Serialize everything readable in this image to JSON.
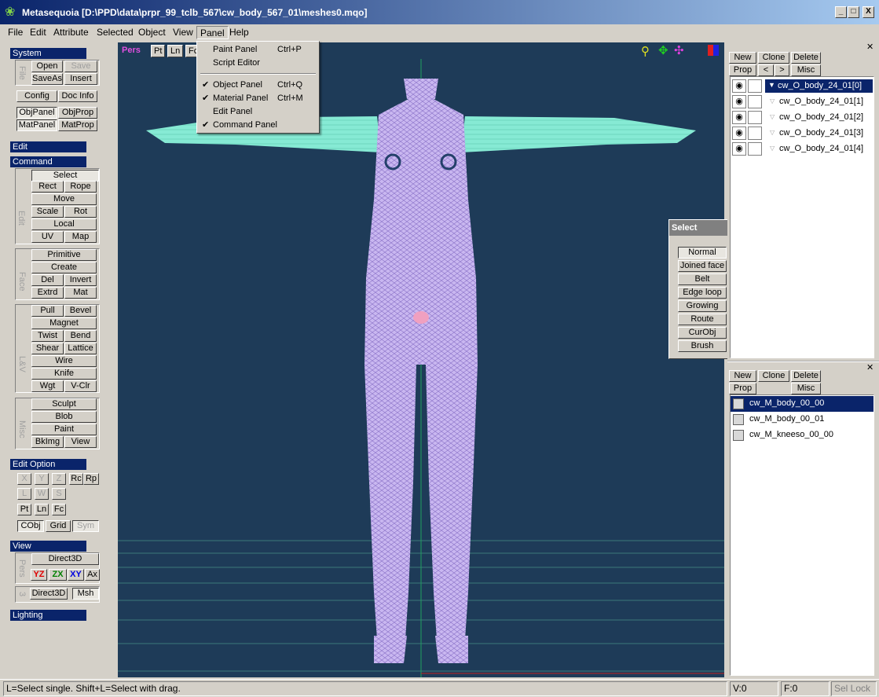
{
  "window": {
    "title": "Metasequoia [D:\\PPD\\data\\prpr_99_tclb_567\\cw_body_567_01\\meshes0.mqo]",
    "minimize": "_",
    "maximize": "□",
    "close": "X"
  },
  "menu": [
    "File",
    "Edit",
    "Attribute",
    "Selected",
    "Object",
    "View",
    "Panel",
    "Help"
  ],
  "panel_menu": {
    "items": [
      {
        "label": "Paint Panel",
        "shortcut": "Ctrl+P",
        "checked": ""
      },
      {
        "label": "Script Editor",
        "shortcut": "",
        "checked": ""
      },
      {
        "label": "Object Panel",
        "shortcut": "Ctrl+Q",
        "checked": "✔"
      },
      {
        "label": "Material Panel",
        "shortcut": "Ctrl+M",
        "checked": "✔"
      },
      {
        "label": "Edit Panel",
        "shortcut": "",
        "checked": ""
      },
      {
        "label": "Command Panel",
        "shortcut": "",
        "checked": "✔"
      }
    ]
  },
  "toolbox": {
    "system": "System",
    "file_label": "File",
    "open": "Open",
    "save": "Save",
    "saveas": "SaveAs",
    "insert": "Insert",
    "config": "Config",
    "docinfo": "Doc Info",
    "objpanel": "ObjPanel",
    "objprop": "ObjProp",
    "matpanel": "MatPanel",
    "matprop": "MatProp",
    "edit": "Edit",
    "command": "Command",
    "edit_label": "Edit",
    "select": "Select",
    "rect": "Rect",
    "rope": "Rope",
    "move": "Move",
    "scale": "Scale",
    "rot": "Rot",
    "local": "Local",
    "uv": "UV",
    "map": "Map",
    "face_label": "Face",
    "primitive": "Primitive",
    "create": "Create",
    "del": "Del",
    "invert": "Invert",
    "extrd": "Extrd",
    "mat": "Mat",
    "lv_label": "L&V",
    "pull": "Pull",
    "bevel": "Bevel",
    "magnet": "Magnet",
    "twist": "Twist",
    "bend": "Bend",
    "shear": "Shear",
    "lattice": "Lattice",
    "wire": "Wire",
    "knife": "Knife",
    "wgt": "Wgt",
    "vclr": "V-Clr",
    "misc_label": "Misc",
    "sculpt": "Sculpt",
    "blob": "Blob",
    "paint": "Paint",
    "bkimg": "BkImg",
    "view": "View",
    "edit_option": "Edit Option",
    "x": "X",
    "y": "Y",
    "z": "Z",
    "rc": "Rc",
    "rp": "Rp",
    "l": "L",
    "w": "W",
    "s": "S",
    "pt": "Pt",
    "ln": "Ln",
    "fc": "Fc",
    "cobj": "CObj",
    "grid": "Grid",
    "sym": "Sym",
    "view_hdr": "View",
    "pers_label": "Pers",
    "direct3d_top": "Direct3D",
    "yz": "YZ",
    "zx": "ZX",
    "xy": "XY",
    "ax": "Ax",
    "three_label": "3",
    "direct3d_bottom": "Direct3D",
    "msh": "Msh",
    "lighting": "Lighting"
  },
  "viewport": {
    "tabs": [
      "Pers",
      "Pt",
      "Ln",
      "Fc"
    ],
    "background": "#1e3b58"
  },
  "select_panel": {
    "title": "Select",
    "items": [
      "Normal",
      "Joined face",
      "Belt",
      "Edge loop",
      "Growing",
      "Route",
      "CurObj",
      "Brush"
    ]
  },
  "object_panel": {
    "new": "New",
    "clone": "Clone",
    "delete": "Delete",
    "prop": "Prop",
    "prev": "<",
    "next": ">",
    "misc": "Misc",
    "objects": [
      "cw_O_body_24_01[0]",
      "cw_O_body_24_01[1]",
      "cw_O_body_24_01[2]",
      "cw_O_body_24_01[3]",
      "cw_O_body_24_01[4]"
    ]
  },
  "material_panel": {
    "new": "New",
    "clone": "Clone",
    "delete": "Delete",
    "prop": "Prop",
    "misc": "Misc",
    "materials": [
      "cw_M_body_00_00",
      "cw_M_body_00_01",
      "cw_M_kneeso_00_00"
    ]
  },
  "status": {
    "hint": "L=Select single.  Shift+L=Select with drag.",
    "v": "V:0",
    "f": "F:0",
    "sellock": "Sel Lock"
  },
  "colors": {
    "accent": "#0a246a",
    "mesh_body": "#c4b4f0",
    "mesh_arms": "#7fe6d0"
  }
}
